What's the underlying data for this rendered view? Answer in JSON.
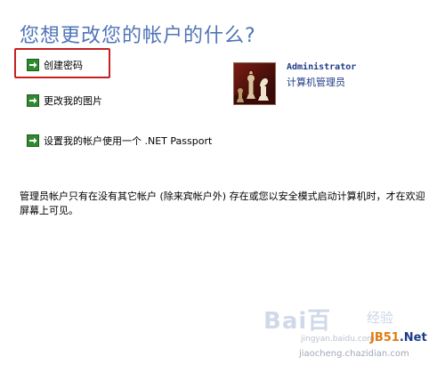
{
  "title": "您想更改您的帐户的什么?",
  "tasks": [
    {
      "label": "创建密码"
    },
    {
      "label": "更改我的图片"
    },
    {
      "label": "设置我的帐户使用一个 .NET Passport"
    }
  ],
  "account": {
    "name": "Administrator",
    "role": "计算机管理员"
  },
  "description": "管理员帐户只有在没有其它帐户 (除来宾帐户外) 存在或您以安全模式启动计算机时，才在欢迎屏幕上可见。",
  "watermarks": {
    "baidu": "Bai",
    "baidu_b": "百",
    "jingyan": "经验",
    "sub": "jingyan.baidu.com",
    "jb51_a": "JB51",
    "jb51_b": ".Net",
    "url": "jiaocheng.chazidian.com"
  },
  "colors": {
    "title": "#4f74b8",
    "highlight": "#c62020",
    "task_arrow": "#2f8a2f"
  }
}
